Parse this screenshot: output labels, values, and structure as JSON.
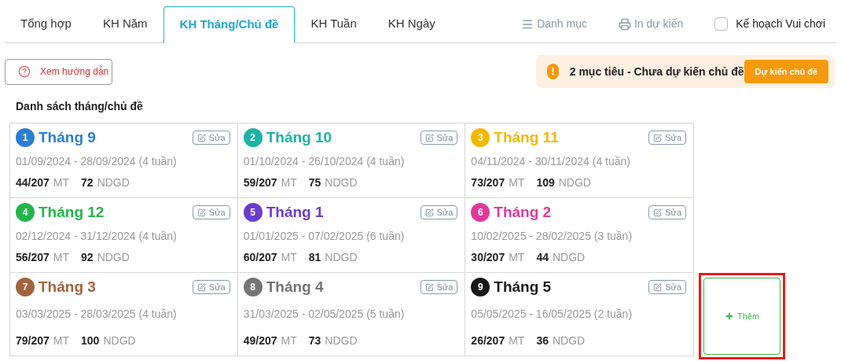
{
  "tabs": [
    {
      "label": "Tổng hợp",
      "selected": false
    },
    {
      "label": "KH Năm",
      "selected": false
    },
    {
      "label": "KH Tháng/Chủ đề",
      "selected": true
    },
    {
      "label": "KH Tuần",
      "selected": false
    },
    {
      "label": "KH Ngày",
      "selected": false
    }
  ],
  "toolbar": {
    "catalog": "Danh mục",
    "print": "In dự kiến",
    "play_plan": {
      "label": "Kế hoạch Vui chơi",
      "checked": false
    }
  },
  "guide_button": "Xem hướng dẫn",
  "alert": {
    "icon": "!",
    "text": "2 mục tiêu - Chưa dự kiến chủ đề",
    "button": "Dự kiến chủ đề"
  },
  "section_title": "Danh sách tháng/chủ đề",
  "months": [
    {
      "number": "1",
      "title": "Tháng 9",
      "color": "#2a7fd4",
      "edit": "Sửa",
      "dates": "01/09/2024 - 28/09/2024 (4 tuần)",
      "mt": "44/207",
      "mt_unit": "MT",
      "ndgd": "72",
      "ndgd_unit": "NDGD"
    },
    {
      "number": "2",
      "title": "Tháng 10",
      "color": "#1ab3a6",
      "edit": "Sửa",
      "dates": "01/10/2024 - 26/10/2024 (4 tuần)",
      "mt": "59/207",
      "mt_unit": "MT",
      "ndgd": "75",
      "ndgd_unit": "NDGD"
    },
    {
      "number": "3",
      "title": "Tháng 11",
      "color": "#f5b800",
      "edit": "Sửa",
      "dates": "04/11/2024 - 30/11/2024 (4 tuần)",
      "mt": "73/207",
      "mt_unit": "MT",
      "ndgd": "109",
      "ndgd_unit": "NDGD"
    },
    {
      "number": "4",
      "title": "Tháng 12",
      "color": "#22b54a",
      "edit": "Sửa",
      "dates": "02/12/2024 - 31/12/2024 (4 tuần)",
      "mt": "56/207",
      "mt_unit": "MT",
      "ndgd": "92",
      "ndgd_unit": "NDGD"
    },
    {
      "number": "5",
      "title": "Tháng 1",
      "color": "#6a3ccf",
      "edit": "Sửa",
      "dates": "01/01/2025 - 07/02/2025 (6 tuần)",
      "mt": "60/207",
      "mt_unit": "MT",
      "ndgd": "81",
      "ndgd_unit": "NDGD"
    },
    {
      "number": "6",
      "title": "Tháng 2",
      "color": "#e0399a",
      "edit": "Sửa",
      "dates": "10/02/2025 - 28/02/2025 (3 tuần)",
      "mt": "30/207",
      "mt_unit": "MT",
      "ndgd": "44",
      "ndgd_unit": "NDGD"
    },
    {
      "number": "7",
      "title": "Tháng 3",
      "color": "#a0633c",
      "edit": "Sửa",
      "dates": "03/03/2025 - 28/03/2025 (4 tuần)",
      "mt": "79/207",
      "mt_unit": "MT",
      "ndgd": "100",
      "ndgd_unit": "NDGD"
    },
    {
      "number": "8",
      "title": "Tháng 4",
      "color": "#757575",
      "edit": "Sửa",
      "dates": "31/03/2025 - 02/05/2025 (5 tuần)",
      "mt": "49/207",
      "mt_unit": "MT",
      "ndgd": "73",
      "ndgd_unit": "NDGD"
    },
    {
      "number": "9",
      "title": "Tháng 5",
      "color": "#1a1a1a",
      "edit": "Sửa",
      "dates": "05/05/2025 - 16/05/2025 (2 tuần)",
      "mt": "26/207",
      "mt_unit": "MT",
      "ndgd": "36",
      "ndgd_unit": "NDGD"
    }
  ],
  "add_button": {
    "label": "Thêm",
    "highlighted": true
  }
}
